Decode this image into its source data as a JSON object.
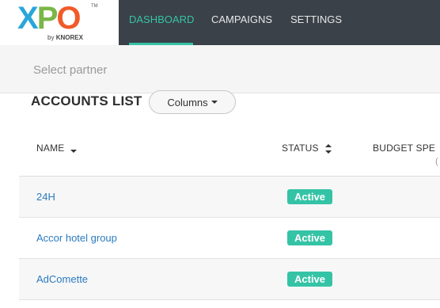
{
  "brand": {
    "logo_x": "X",
    "logo_p": "P",
    "logo_o": "O",
    "tm": "TM",
    "by": "by",
    "company": "KNOREX",
    "colors": {
      "x": "#2aa6d9",
      "p": "#7ab648",
      "o": "#f15a29"
    }
  },
  "nav": {
    "items": [
      {
        "label": "DASHBOARD",
        "active": true
      },
      {
        "label": "CAMPAIGNS",
        "active": false
      },
      {
        "label": "SETTINGS",
        "active": false
      }
    ],
    "active_color": "#35c3a6"
  },
  "partner": {
    "placeholder": "Select partner"
  },
  "accounts": {
    "title": "ACCOUNTS LIST",
    "columns_button": "Columns"
  },
  "table": {
    "headers": {
      "name": "NAME",
      "status": "STATUS",
      "budget": "BUDGET SPE",
      "budget_sub": "("
    },
    "rows": [
      {
        "name": "24H",
        "status": "Active"
      },
      {
        "name": "Accor hotel group",
        "status": "Active"
      },
      {
        "name": "AdComette",
        "status": "Active"
      }
    ],
    "status_color": "#35c3a6"
  }
}
